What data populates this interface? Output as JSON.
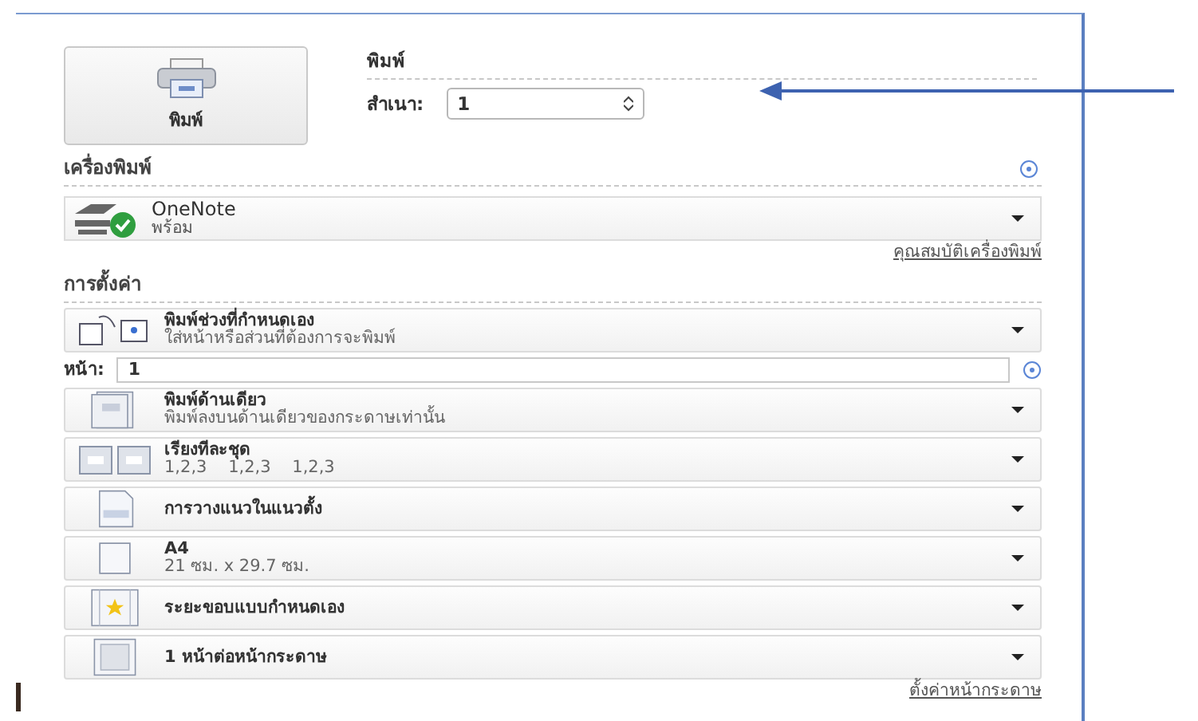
{
  "print_button": {
    "label": "พิมพ์"
  },
  "print_section": {
    "title": "พิมพ์",
    "copies_label": "สำเนา:",
    "copies_value": "1"
  },
  "printer_section": {
    "title": "เครื่องพิมพ์",
    "printer": {
      "name": "OneNote",
      "status": "พร้อม",
      "ready": true
    },
    "link": "คุณสมบัติเครื่องพิมพ์"
  },
  "settings_section": {
    "title": "การตั้งค่า",
    "items": [
      {
        "kind": "range",
        "title": "พิมพ์ช่วงที่กำหนดเอง",
        "subtitle": "ใส่หน้าหรือส่วนที่ต้องการจะพิมพ์"
      },
      {
        "kind": "field",
        "label": "หน้า:",
        "value": "1"
      },
      {
        "kind": "sides",
        "title": "พิมพ์ด้านเดียว",
        "subtitle": "พิมพ์ลงบนด้านเดียวของกระดาษเท่านั้น"
      },
      {
        "kind": "collate",
        "title": "เรียงทีละชุด",
        "subtitle": "1,2,3    1,2,3    1,2,3"
      },
      {
        "kind": "orientation",
        "title": "การวางแนวในแนวตั้ง"
      },
      {
        "kind": "paper",
        "title": "A4",
        "subtitle": "21 ซม. x 29.7 ซม."
      },
      {
        "kind": "margins",
        "title": "ระยะขอบแบบกำหนดเอง"
      },
      {
        "kind": "persheet",
        "title": "1 หน้าต่อหน้ากระดาษ"
      }
    ],
    "link": "ตั้งค่าหน้ากระดาษ"
  }
}
